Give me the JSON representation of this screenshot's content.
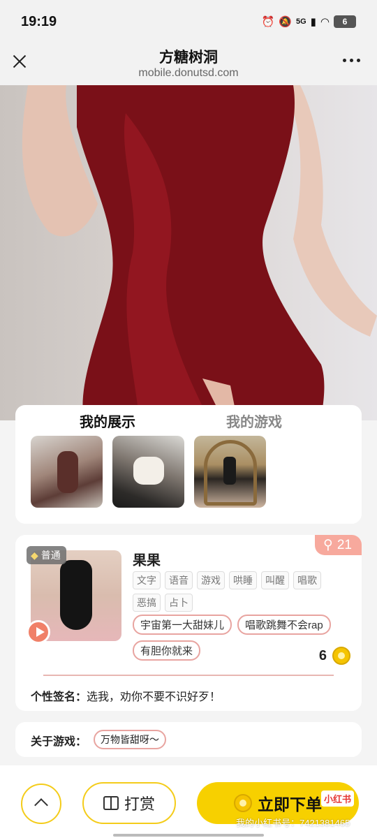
{
  "status_bar": {
    "time": "19:19",
    "network": "5G",
    "battery": "6"
  },
  "nav": {
    "title": "方糖树洞",
    "url": "mobile.donutsd.com"
  },
  "showcase": {
    "tabs": [
      {
        "label": "我的展示"
      },
      {
        "label": "我的游戏"
      }
    ]
  },
  "profile": {
    "level_badge": "普通",
    "views": "21",
    "name": "果果",
    "tags": [
      "文字",
      "语音",
      "游戏",
      "哄睡",
      "叫醒",
      "唱歌",
      "恶搞",
      "占卜"
    ],
    "pills": [
      "宇宙第一大甜妹儿",
      "唱歌跳舞不会rap",
      "有胆你就来"
    ],
    "gift_count": "6",
    "signature_label": "个性签名：",
    "signature_text": "选我，劝你不要不识好歹！"
  },
  "about": {
    "label": "关于游戏：",
    "value": "万物皆甜呀～"
  },
  "bottom": {
    "reward_label": "打赏",
    "order_label": "立即下单",
    "xhs_badge": "小红书",
    "watermark": "我的小红书号：7421381465"
  },
  "colors": {
    "accent": "#f7d000",
    "pill_border": "#e8a4a0",
    "views_badge": "#f7a99d"
  }
}
